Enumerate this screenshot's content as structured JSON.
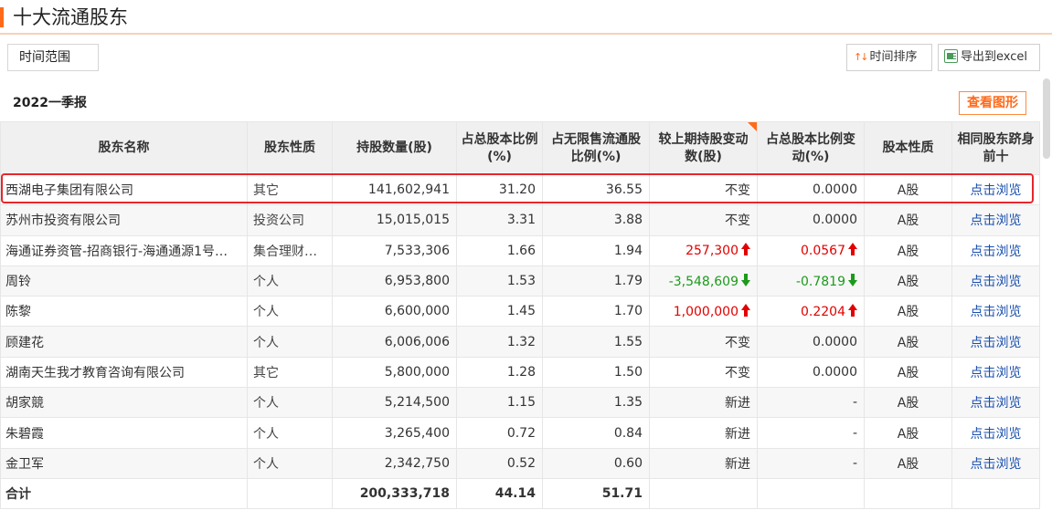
{
  "header": {
    "title": "十大流通股东"
  },
  "toolbar": {
    "range_label": "时间范围",
    "sort_label": "时间排序",
    "sort_arrows": "↑↓",
    "export_label": "导出到excel"
  },
  "period": "2022一季报",
  "chart_button": "查看图形",
  "columns": [
    "股东名称",
    "股东性质",
    "持股数量(股)",
    "占总股本比例(%)",
    "占无限售流通股比例(%)",
    "较上期持股变动数(股)",
    "占总股本比例变动(%)",
    "股本性质",
    "相同股东跻身前十"
  ],
  "rows": [
    {
      "name": "西湖电子集团有限公司",
      "nature": "其它",
      "shares": "141,602,941",
      "pct_total": "31.20",
      "pct_float": "36.55",
      "change": "不变",
      "change_dir": "none",
      "pct_change": "0.0000",
      "pct_change_dir": "none",
      "share_type": "A股",
      "link": "点击浏览"
    },
    {
      "name": "苏州市投资有限公司",
      "nature": "投资公司",
      "shares": "15,015,015",
      "pct_total": "3.31",
      "pct_float": "3.88",
      "change": "不变",
      "change_dir": "none",
      "pct_change": "0.0000",
      "pct_change_dir": "none",
      "share_type": "A股",
      "link": "点击浏览"
    },
    {
      "name": "海通证券资管-招商银行-海通通源1号…",
      "nature": "集合理财…",
      "shares": "7,533,306",
      "pct_total": "1.66",
      "pct_float": "1.94",
      "change": "257,300",
      "change_dir": "up",
      "pct_change": "0.0567",
      "pct_change_dir": "up",
      "share_type": "A股",
      "link": "点击浏览"
    },
    {
      "name": "周铃",
      "nature": "个人",
      "shares": "6,953,800",
      "pct_total": "1.53",
      "pct_float": "1.79",
      "change": "-3,548,609",
      "change_dir": "down",
      "pct_change": "-0.7819",
      "pct_change_dir": "down",
      "share_type": "A股",
      "link": "点击浏览"
    },
    {
      "name": "陈黎",
      "nature": "个人",
      "shares": "6,600,000",
      "pct_total": "1.45",
      "pct_float": "1.70",
      "change": "1,000,000",
      "change_dir": "up",
      "pct_change": "0.2204",
      "pct_change_dir": "up",
      "share_type": "A股",
      "link": "点击浏览"
    },
    {
      "name": "顾建花",
      "nature": "个人",
      "shares": "6,006,006",
      "pct_total": "1.32",
      "pct_float": "1.55",
      "change": "不变",
      "change_dir": "none",
      "pct_change": "0.0000",
      "pct_change_dir": "none",
      "share_type": "A股",
      "link": "点击浏览"
    },
    {
      "name": "湖南天生我才教育咨询有限公司",
      "nature": "其它",
      "shares": "5,800,000",
      "pct_total": "1.28",
      "pct_float": "1.50",
      "change": "不变",
      "change_dir": "none",
      "pct_change": "0.0000",
      "pct_change_dir": "none",
      "share_type": "A股",
      "link": "点击浏览"
    },
    {
      "name": "胡家競",
      "nature": "个人",
      "shares": "5,214,500",
      "pct_total": "1.15",
      "pct_float": "1.35",
      "change": "新进",
      "change_dir": "none",
      "pct_change": "-",
      "pct_change_dir": "none",
      "share_type": "A股",
      "link": "点击浏览"
    },
    {
      "name": "朱碧霞",
      "nature": "个人",
      "shares": "3,265,400",
      "pct_total": "0.72",
      "pct_float": "0.84",
      "change": "新进",
      "change_dir": "none",
      "pct_change": "-",
      "pct_change_dir": "none",
      "share_type": "A股",
      "link": "点击浏览"
    },
    {
      "name": "金卫军",
      "nature": "个人",
      "shares": "2,342,750",
      "pct_total": "0.52",
      "pct_float": "0.60",
      "change": "新进",
      "change_dir": "none",
      "pct_change": "-",
      "pct_change_dir": "none",
      "share_type": "A股",
      "link": "点击浏览"
    }
  ],
  "total": {
    "label": "合计",
    "shares": "200,333,718",
    "pct_total": "44.14",
    "pct_float": "51.71"
  },
  "colors": {
    "accent": "#ff6a1a",
    "up": "#e20000",
    "down": "#1c9a1c",
    "link": "#1a4fae",
    "highlight": "#e8262c"
  }
}
